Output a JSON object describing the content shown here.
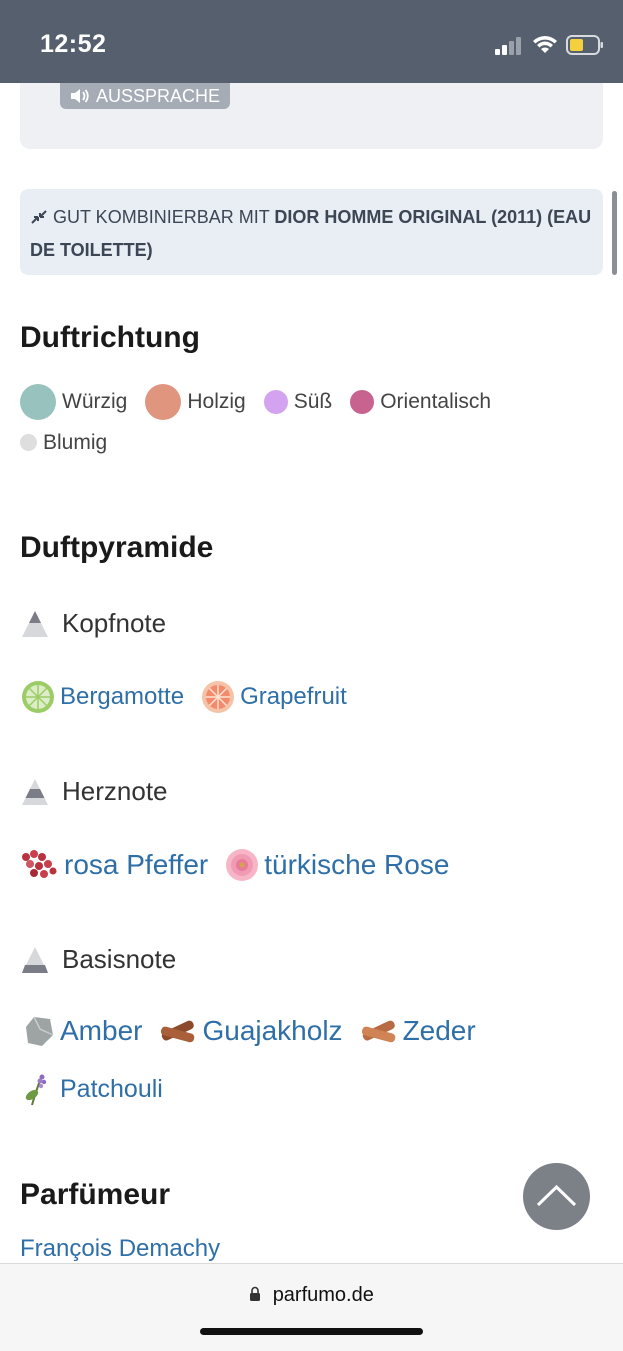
{
  "status": {
    "time": "12:52"
  },
  "pronunciation": {
    "label": "AUSSPRACHE"
  },
  "combine": {
    "prefix": "GUT KOMBINIERBAR MIT",
    "product": "DIOR HOMME ORIGINAL (2011) (EAU DE TOILETTE)"
  },
  "duftrichtung": {
    "title": "Duftrichtung",
    "items": [
      {
        "label": "Würzig",
        "color": "#97c2bd"
      },
      {
        "label": "Holzig",
        "color": "#e0957f"
      },
      {
        "label": "Süß",
        "color": "#d3a3ef"
      },
      {
        "label": "Orientalisch",
        "color": "#c8628f"
      },
      {
        "label": "Blumig",
        "color": "#dedede"
      }
    ]
  },
  "pyramid": {
    "title": "Duftpyramide",
    "tiers": [
      {
        "label": "Kopfnote",
        "notes": [
          "Bergamotte",
          "Grapefruit"
        ]
      },
      {
        "label": "Herznote",
        "notes": [
          "rosa Pfeffer",
          "türkische Rose"
        ]
      },
      {
        "label": "Basisnote",
        "notes": [
          "Amber",
          "Guajakholz",
          "Zeder",
          "Patchouli"
        ]
      }
    ]
  },
  "parfumeur": {
    "title": "Parfümeur",
    "name": "François Demachy"
  },
  "browser": {
    "url": "parfumo.de"
  }
}
